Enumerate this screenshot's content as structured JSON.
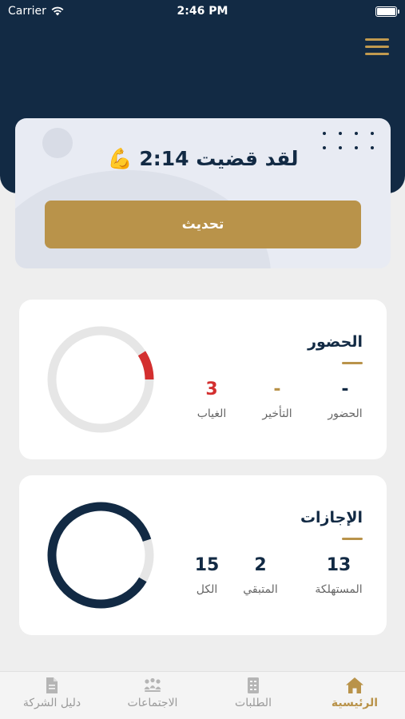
{
  "status_bar": {
    "carrier": "Carrier",
    "time": "2:46 PM"
  },
  "header": {
    "menu_icon": "hamburger-icon"
  },
  "timer": {
    "title": "لقد قضيت 2:14 💪",
    "update_label": "تحديث"
  },
  "attendance": {
    "title": "الحضور",
    "stats": [
      {
        "label": "الحضور",
        "value": "-"
      },
      {
        "label": "التأخير",
        "value": "-"
      },
      {
        "label": "الغياب",
        "value": "3"
      }
    ],
    "colors": {
      "value_default": "#122a44",
      "late": "#b9934a",
      "absence": "#d32f2f"
    }
  },
  "leaves": {
    "title": "الإجازات",
    "stats": [
      {
        "label": "المستهلكة",
        "value": "13"
      },
      {
        "label": "المتبقي",
        "value": "2"
      },
      {
        "label": "الكل",
        "value": "15"
      }
    ],
    "colors": {
      "value": "#122a44",
      "ring": "#122a44",
      "track": "#e6e6e6"
    }
  },
  "tabs": [
    {
      "label": "الرئيسية",
      "icon": "home-icon",
      "active": true
    },
    {
      "label": "الطلبات",
      "icon": "document-list-icon",
      "active": false
    },
    {
      "label": "الاجتماعات",
      "icon": "meeting-icon",
      "active": false
    },
    {
      "label": "دليل الشركة",
      "icon": "file-icon",
      "active": false
    }
  ],
  "theme": {
    "navy": "#122a44",
    "gold": "#b9934a",
    "red": "#d32f2f"
  },
  "chart_data": [
    {
      "type": "pie",
      "categories": [
        "الغياب",
        "other"
      ],
      "values": [
        3,
        97
      ],
      "donut": true
    },
    {
      "type": "pie",
      "categories": [
        "المستهلكة",
        "المتبقي"
      ],
      "values": [
        13,
        2
      ],
      "donut": true
    }
  ]
}
